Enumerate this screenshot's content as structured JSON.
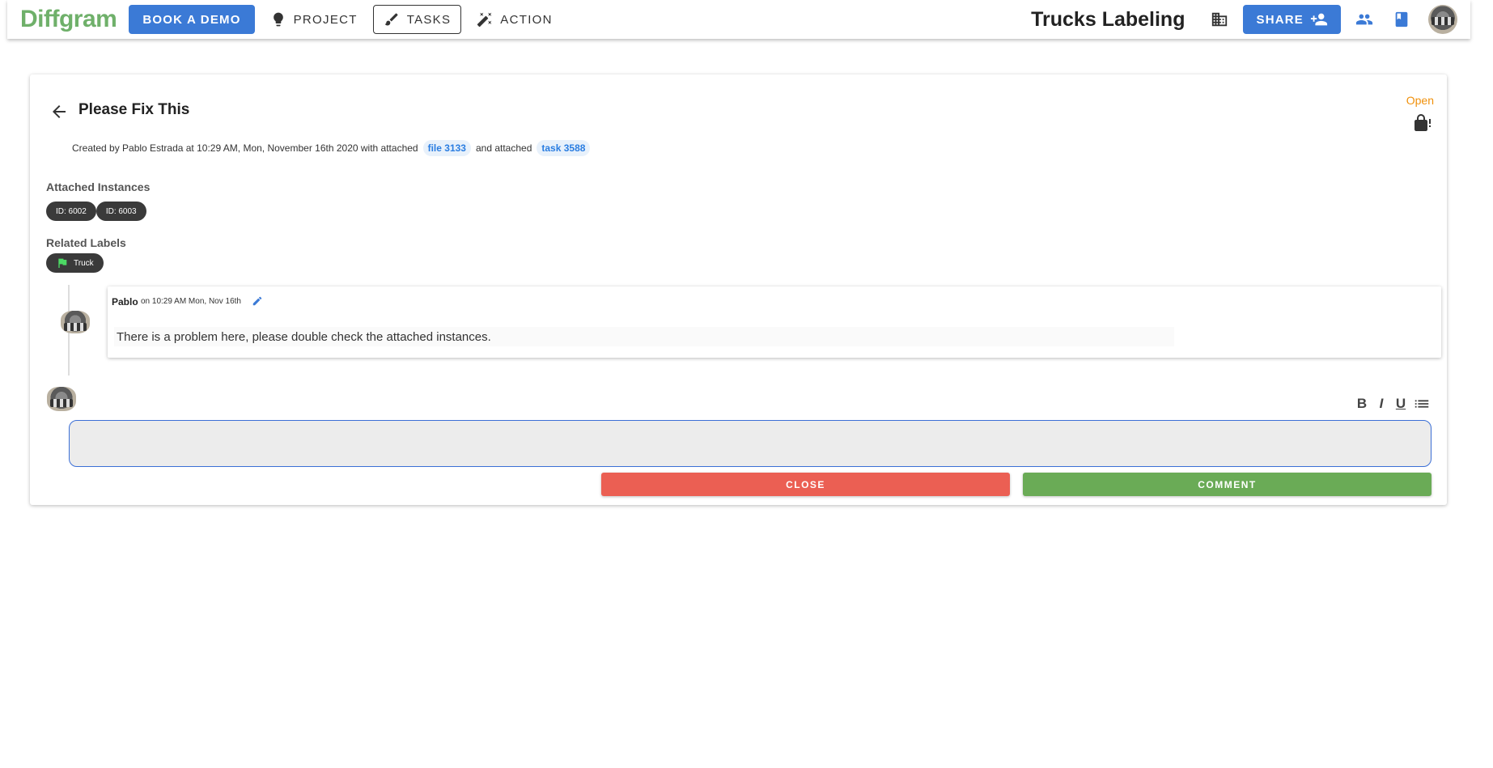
{
  "topbar": {
    "logo": "Diffgram",
    "book_demo": "BOOK A DEMO",
    "nav": [
      {
        "label": "PROJECT",
        "icon": "lightbulb-icon"
      },
      {
        "label": "TASKS",
        "icon": "brush-icon"
      },
      {
        "label": "ACTION",
        "icon": "magic-wand-icon"
      }
    ],
    "project_title": "Trucks Labeling",
    "share": "SHARE"
  },
  "issue": {
    "title": "Please Fix This",
    "status": "Open",
    "meta_prefix": "Created by Pablo Estrada at 10:29 AM, Mon, November 16th 2020 with attached",
    "file_link": "file 3133",
    "meta_mid": "and attached",
    "task_link": "task 3588",
    "instances_label": "Attached Instances",
    "instances": [
      "ID: 6002",
      "ID: 6003"
    ],
    "labels_label": "Related Labels",
    "labels": [
      "Truck"
    ]
  },
  "comment": {
    "author": "Pablo",
    "time": "on 10:29 AM Mon, Nov 16th",
    "body": "There is a problem here, please double check the attached instances."
  },
  "editor": {
    "toolbar": [
      "B",
      "I",
      "U"
    ]
  },
  "actions": {
    "close": "CLOSE",
    "comment": "COMMENT"
  },
  "colors": {
    "brand_green": "#6fb06a",
    "primary_blue": "#3b7ad6",
    "close_red": "#eb5f53",
    "comment_green": "#6aab56",
    "status_orange": "#f0900a"
  }
}
